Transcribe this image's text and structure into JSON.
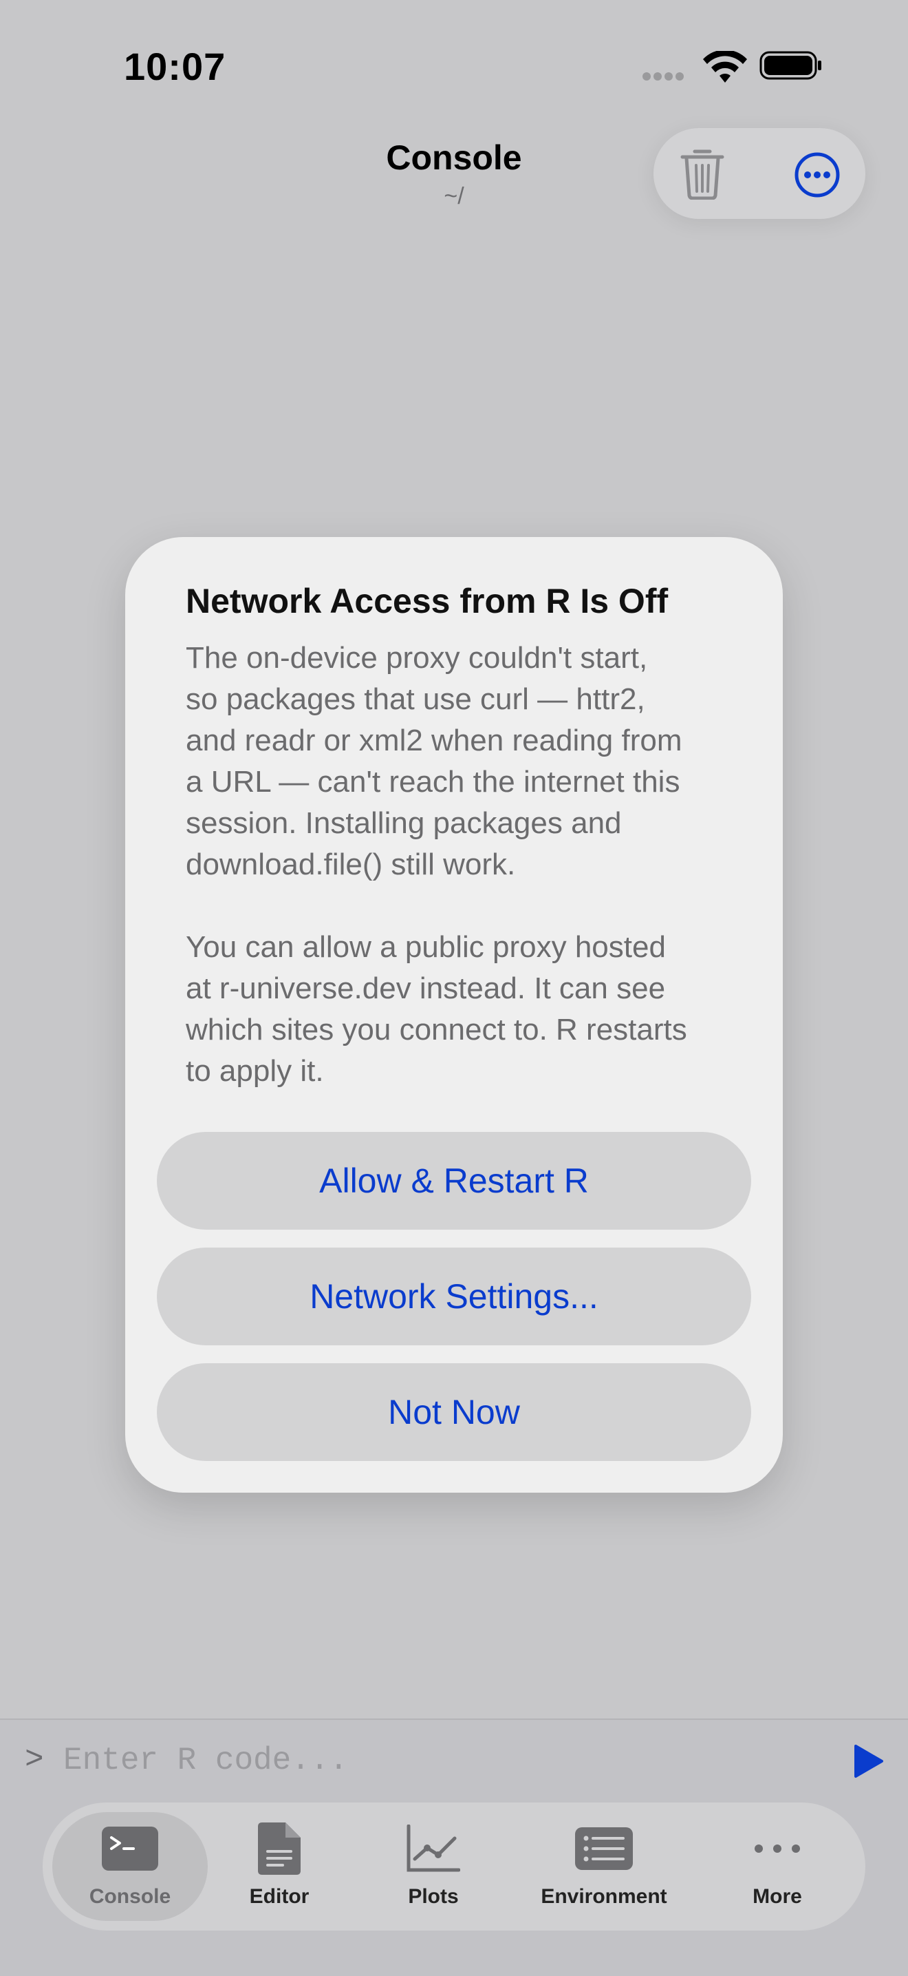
{
  "status_bar": {
    "time": "10:07"
  },
  "header": {
    "title": "Console",
    "subtitle": "~/"
  },
  "toolbar": {
    "trash_icon": "trash-icon",
    "more_icon": "ellipsis-circle-icon"
  },
  "dialog": {
    "title": "Network Access from R Is Off",
    "body": "The on-device proxy couldn't start,\nso packages that use curl — httr2,\nand readr or xml2 when reading from\na URL — can't reach the internet this\nsession. Installing packages and\ndownload.file() still work.\n\nYou can allow a public proxy hosted\nat r-universe.dev instead. It can see\nwhich sites you connect to. R restarts\nto apply it.",
    "buttons": [
      "Allow & Restart R",
      "Network Settings...",
      "Not Now"
    ]
  },
  "input": {
    "prompt": ">",
    "placeholder": "Enter R code...",
    "value": ""
  },
  "tabs": [
    {
      "label": "Console",
      "icon": "terminal-icon",
      "active": true
    },
    {
      "label": "Editor",
      "icon": "document-icon",
      "active": false
    },
    {
      "label": "Plots",
      "icon": "chart-line-icon",
      "active": false
    },
    {
      "label": "Environment",
      "icon": "list-icon",
      "active": false
    },
    {
      "label": "More",
      "icon": "ellipsis-icon",
      "active": false
    }
  ],
  "colors": {
    "accent": "#0a3ccd",
    "background": "#c7c7c9"
  }
}
